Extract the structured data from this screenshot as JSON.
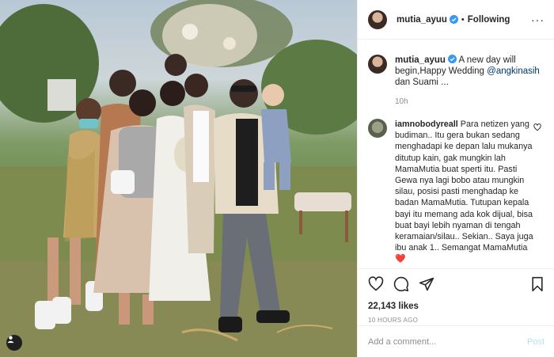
{
  "post": {
    "username": "mutia_ayuu",
    "follow_label": "Following",
    "more_icon": "more-options-icon",
    "caption_lines": [
      "A new day will begin,Happy Wedding ",
      "dan Suami ..."
    ],
    "caption_mention": "@angkinasih",
    "caption_age": "10h",
    "likes": "22,143 likes",
    "timestamp": "10 HOURS AGO"
  },
  "comment": {
    "username": "iamnobodyreall",
    "text": "Para netizen yang budiman.. Itu gera bukan sedang menghadapi ke depan lalu mukanya ditutup kain, gak mungkin lah MamaMutia buat sperti itu. Pasti Gewa nya lagi bobo atau mungkin silau, posisi pasti menghadap ke badan MamaMutia. Tutupan kepala bayi itu memang ada kok dijual, bisa buat bayi lebih nyaman di tengah keramaian/silau.. Sekian.. Saya juga ibu anak 1.. Semangat MamaMutia ❤️"
  },
  "add_comment": {
    "placeholder": "Add a comment...",
    "post_label": "Post"
  },
  "colors": {
    "verified": "#3897f0",
    "link": "#00376b",
    "muted": "#8e8e8e",
    "post_disabled": "#b2dffc"
  }
}
